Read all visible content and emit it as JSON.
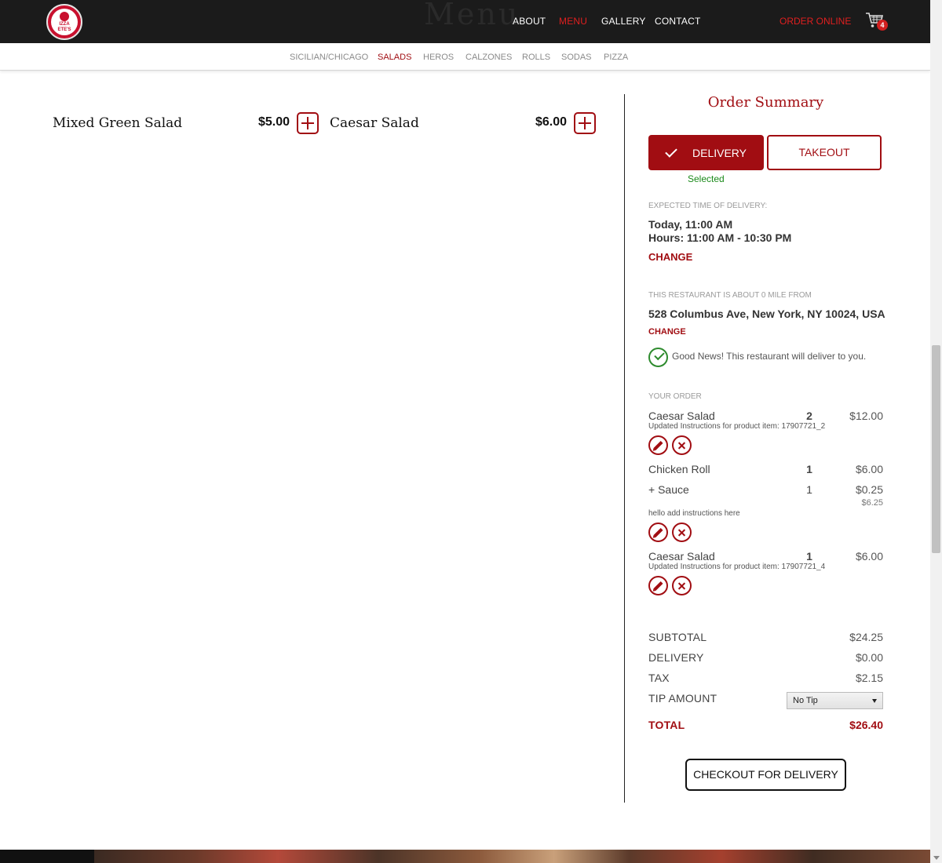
{
  "header": {
    "logo_alt": "Pizza Pete's",
    "logo_text": "IZZA ETE'S",
    "menu_ghost_title": "Menu",
    "nav": [
      {
        "label": "ABOUT",
        "active": false
      },
      {
        "label": "MENU",
        "active": true
      },
      {
        "label": "GALLERY",
        "active": false
      },
      {
        "label": "CONTACT",
        "active": false
      }
    ],
    "order_online": "ORDER ONLINE",
    "cart_count": "4"
  },
  "categories": [
    {
      "label": "SICILIAN/CHICAGO",
      "active": false
    },
    {
      "label": "SALADS",
      "active": true
    },
    {
      "label": "HEROS",
      "active": false
    },
    {
      "label": "CALZONES",
      "active": false
    },
    {
      "label": "ROLLS",
      "active": false
    },
    {
      "label": "SODAS",
      "active": false
    },
    {
      "label": "PIZZA",
      "active": false
    }
  ],
  "menu_items": [
    {
      "name": "Mixed Green Salad",
      "price": "$5.00"
    },
    {
      "name": "Caesar Salad",
      "price": "$6.00"
    }
  ],
  "order_summary": {
    "title": "Order Summary",
    "delivery_label": "DELIVERY",
    "takeout_label": "TAKEOUT",
    "selected_label": "Selected",
    "expected_time_label": "EXPECTED TIME OF DELIVERY:",
    "expected_time": "Today, 11:00 AM",
    "hours": "Hours: 11:00 AM - 10:30 PM",
    "change_time": "CHANGE",
    "distance_label": "THIS RESTAURANT IS ABOUT 0 MILE FROM",
    "address": "528 Columbus Ave, New York, NY 10024, USA",
    "change_address": "CHANGE",
    "good_news": "Good News! This restaurant will deliver to you.",
    "your_order_label": "YOUR ORDER",
    "lines": [
      {
        "name": "Caesar Salad",
        "qty": "2",
        "price": "$12.00",
        "note": "Updated Instructions for product item: 17907721_2"
      },
      {
        "name": "Chicken Roll",
        "qty": "1",
        "price": "$6.00",
        "addon": {
          "name": "+ Sauce",
          "qty": "1",
          "price": "$0.25"
        },
        "subtotal": "$6.25",
        "note": "hello add instructions here"
      },
      {
        "name": "Caesar Salad",
        "qty": "1",
        "price": "$6.00",
        "note": "Updated Instructions for product item: 17907721_4"
      }
    ],
    "subtotal_label": "SUBTOTAL",
    "subtotal": "$24.25",
    "delivery_fee_label": "DELIVERY",
    "delivery_fee": "$0.00",
    "tax_label": "TAX",
    "tax": "$2.15",
    "tip_label": "TIP AMOUNT",
    "tip_selected": "No Tip",
    "total_label": "TOTAL",
    "total": "$26.40",
    "checkout_label": "CHECKOUT FOR DELIVERY"
  },
  "colors": {
    "brand_red": "#a10d12",
    "nav_active": "#e01f1f",
    "success_green": "#2e8b2e",
    "header_bg": "#1b1b1b"
  }
}
